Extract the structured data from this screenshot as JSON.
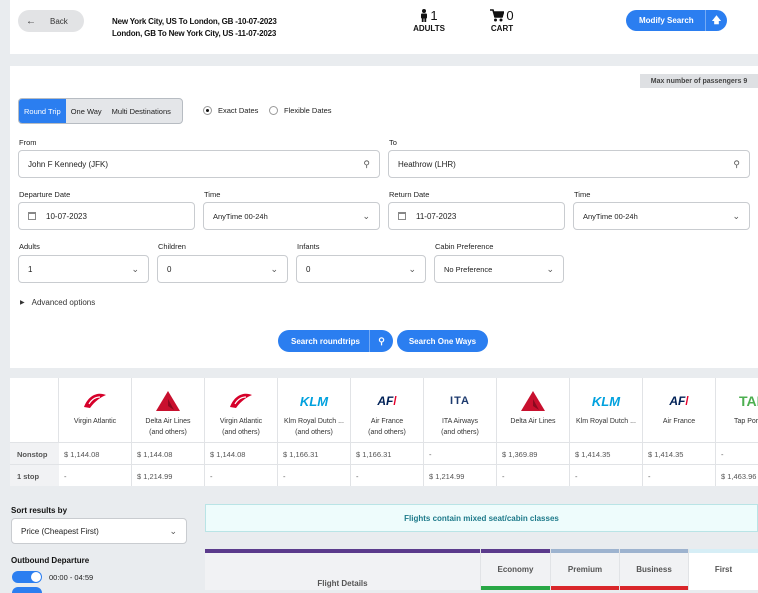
{
  "header": {
    "back_label": "Back",
    "route_line1": "New York City, US To London, GB -10-07-2023",
    "route_line2": "London, GB To New York City, US -11-07-2023",
    "adults_count": "1",
    "adults_label": "ADULTS",
    "cart_count": "0",
    "cart_label": "CART",
    "modify_label": "Modify Search"
  },
  "search": {
    "max_passengers": "Max number of passengers 9",
    "trip_types": [
      "Round Trip",
      "One Way",
      "Multi Destinations"
    ],
    "date_modes": [
      "Exact Dates",
      "Flexible Dates"
    ],
    "from_label": "From",
    "from_value": "John F Kennedy (JFK)",
    "to_label": "To",
    "to_value": "Heathrow (LHR)",
    "departure_label": "Departure Date",
    "departure_value": "10-07-2023",
    "time_label": "Time",
    "departure_time": "AnyTime 00-24h",
    "return_label": "Return Date",
    "return_value": "11-07-2023",
    "return_time": "AnyTime 00-24h",
    "adults_label": "Adults",
    "adults_value": "1",
    "children_label": "Children",
    "children_value": "0",
    "infants_label": "Infants",
    "infants_value": "0",
    "cabin_label": "Cabin Preference",
    "cabin_value": "No Preference",
    "advanced_label": "Advanced options",
    "search_roundtrips": "Search roundtrips",
    "search_oneways": "Search One Ways"
  },
  "matrix": {
    "airlines": [
      {
        "logo": "Virgin",
        "name1": "Virgin Atlantic",
        "name2": ""
      },
      {
        "logo": "delta",
        "name1": "Delta Air Lines",
        "name2": "(and others)"
      },
      {
        "logo": "Virgin",
        "name1": "Virgin Atlantic",
        "name2": "(and others)"
      },
      {
        "logo": "KLM",
        "name1": "Klm Royal Dutch ...",
        "name2": "(and others)"
      },
      {
        "logo": "AF",
        "name1": "Air France",
        "name2": "(and others)"
      },
      {
        "logo": "ITA",
        "name1": "ITA Airways",
        "name2": "(and others)"
      },
      {
        "logo": "delta",
        "name1": "Delta Air Lines",
        "name2": ""
      },
      {
        "logo": "KLM",
        "name1": "Klm Royal Dutch ...",
        "name2": ""
      },
      {
        "logo": "AF",
        "name1": "Air France",
        "name2": ""
      },
      {
        "logo": "TAP",
        "name1": "Tap Portu",
        "name2": ""
      }
    ],
    "rows": [
      {
        "label": "Nonstop",
        "cells": [
          "$ 1,144.08",
          "$ 1,144.08",
          "$ 1,144.08",
          "$ 1,166.31",
          "$ 1,166.31",
          "-",
          "$ 1,369.89",
          "$ 1,414.35",
          "$ 1,414.35",
          "-"
        ]
      },
      {
        "label": "1 stop",
        "cells": [
          "-",
          "$ 1,214.99",
          "-",
          "-",
          "-",
          "$ 1,214.99",
          "-",
          "-",
          "-",
          "$ 1,463.96"
        ]
      }
    ]
  },
  "filters": {
    "sort_label": "Sort results by",
    "sort_value": "Price (Cheapest First)",
    "outbound_label": "Outbound Departure",
    "outbound_range": "00:00 - 04:59"
  },
  "results": {
    "mixed_notice": "Flights contain mixed seat/cabin classes",
    "col_details": "Flight Details",
    "col_economy": "Economy",
    "col_premium": "Premium",
    "col_business": "Business",
    "col_first": "First"
  },
  "colors": {
    "accent": "#2b7ef0",
    "delta_red": "#c8102e",
    "virgin_red": "#d6002a",
    "klm_blue": "#00a1de",
    "af_blue": "#002157",
    "af_red": "#e4002b",
    "header_purple": "#5b3b8c",
    "economy_green": "#28a745",
    "unavail_red": "#d9262a"
  }
}
